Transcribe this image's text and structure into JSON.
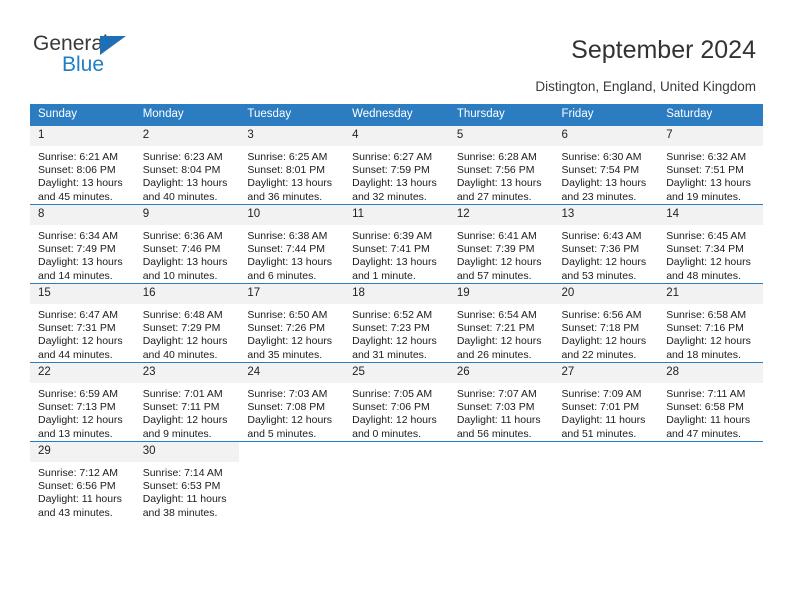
{
  "brand": {
    "name_top": "General",
    "name_bottom": "Blue",
    "accent_color": "#1f7ec4",
    "triangle_color": "#1f6fb5"
  },
  "header": {
    "title": "September 2024",
    "subtitle": "Distington, England, United Kingdom"
  },
  "calendar": {
    "header_bg": "#2b7cc0",
    "header_text_color": "#ffffff",
    "date_band_bg": "#f2f2f2",
    "weekday_headers": [
      "Sunday",
      "Monday",
      "Tuesday",
      "Wednesday",
      "Thursday",
      "Friday",
      "Saturday"
    ],
    "weeks": [
      [
        {
          "date": "1",
          "sunrise": "Sunrise: 6:21 AM",
          "sunset": "Sunset: 8:06 PM",
          "daylight_line1": "Daylight: 13 hours",
          "daylight_line2": "and 45 minutes."
        },
        {
          "date": "2",
          "sunrise": "Sunrise: 6:23 AM",
          "sunset": "Sunset: 8:04 PM",
          "daylight_line1": "Daylight: 13 hours",
          "daylight_line2": "and 40 minutes."
        },
        {
          "date": "3",
          "sunrise": "Sunrise: 6:25 AM",
          "sunset": "Sunset: 8:01 PM",
          "daylight_line1": "Daylight: 13 hours",
          "daylight_line2": "and 36 minutes."
        },
        {
          "date": "4",
          "sunrise": "Sunrise: 6:27 AM",
          "sunset": "Sunset: 7:59 PM",
          "daylight_line1": "Daylight: 13 hours",
          "daylight_line2": "and 32 minutes."
        },
        {
          "date": "5",
          "sunrise": "Sunrise: 6:28 AM",
          "sunset": "Sunset: 7:56 PM",
          "daylight_line1": "Daylight: 13 hours",
          "daylight_line2": "and 27 minutes."
        },
        {
          "date": "6",
          "sunrise": "Sunrise: 6:30 AM",
          "sunset": "Sunset: 7:54 PM",
          "daylight_line1": "Daylight: 13 hours",
          "daylight_line2": "and 23 minutes."
        },
        {
          "date": "7",
          "sunrise": "Sunrise: 6:32 AM",
          "sunset": "Sunset: 7:51 PM",
          "daylight_line1": "Daylight: 13 hours",
          "daylight_line2": "and 19 minutes."
        }
      ],
      [
        {
          "date": "8",
          "sunrise": "Sunrise: 6:34 AM",
          "sunset": "Sunset: 7:49 PM",
          "daylight_line1": "Daylight: 13 hours",
          "daylight_line2": "and 14 minutes."
        },
        {
          "date": "9",
          "sunrise": "Sunrise: 6:36 AM",
          "sunset": "Sunset: 7:46 PM",
          "daylight_line1": "Daylight: 13 hours",
          "daylight_line2": "and 10 minutes."
        },
        {
          "date": "10",
          "sunrise": "Sunrise: 6:38 AM",
          "sunset": "Sunset: 7:44 PM",
          "daylight_line1": "Daylight: 13 hours",
          "daylight_line2": "and 6 minutes."
        },
        {
          "date": "11",
          "sunrise": "Sunrise: 6:39 AM",
          "sunset": "Sunset: 7:41 PM",
          "daylight_line1": "Daylight: 13 hours",
          "daylight_line2": "and 1 minute."
        },
        {
          "date": "12",
          "sunrise": "Sunrise: 6:41 AM",
          "sunset": "Sunset: 7:39 PM",
          "daylight_line1": "Daylight: 12 hours",
          "daylight_line2": "and 57 minutes."
        },
        {
          "date": "13",
          "sunrise": "Sunrise: 6:43 AM",
          "sunset": "Sunset: 7:36 PM",
          "daylight_line1": "Daylight: 12 hours",
          "daylight_line2": "and 53 minutes."
        },
        {
          "date": "14",
          "sunrise": "Sunrise: 6:45 AM",
          "sunset": "Sunset: 7:34 PM",
          "daylight_line1": "Daylight: 12 hours",
          "daylight_line2": "and 48 minutes."
        }
      ],
      [
        {
          "date": "15",
          "sunrise": "Sunrise: 6:47 AM",
          "sunset": "Sunset: 7:31 PM",
          "daylight_line1": "Daylight: 12 hours",
          "daylight_line2": "and 44 minutes."
        },
        {
          "date": "16",
          "sunrise": "Sunrise: 6:48 AM",
          "sunset": "Sunset: 7:29 PM",
          "daylight_line1": "Daylight: 12 hours",
          "daylight_line2": "and 40 minutes."
        },
        {
          "date": "17",
          "sunrise": "Sunrise: 6:50 AM",
          "sunset": "Sunset: 7:26 PM",
          "daylight_line1": "Daylight: 12 hours",
          "daylight_line2": "and 35 minutes."
        },
        {
          "date": "18",
          "sunrise": "Sunrise: 6:52 AM",
          "sunset": "Sunset: 7:23 PM",
          "daylight_line1": "Daylight: 12 hours",
          "daylight_line2": "and 31 minutes."
        },
        {
          "date": "19",
          "sunrise": "Sunrise: 6:54 AM",
          "sunset": "Sunset: 7:21 PM",
          "daylight_line1": "Daylight: 12 hours",
          "daylight_line2": "and 26 minutes."
        },
        {
          "date": "20",
          "sunrise": "Sunrise: 6:56 AM",
          "sunset": "Sunset: 7:18 PM",
          "daylight_line1": "Daylight: 12 hours",
          "daylight_line2": "and 22 minutes."
        },
        {
          "date": "21",
          "sunrise": "Sunrise: 6:58 AM",
          "sunset": "Sunset: 7:16 PM",
          "daylight_line1": "Daylight: 12 hours",
          "daylight_line2": "and 18 minutes."
        }
      ],
      [
        {
          "date": "22",
          "sunrise": "Sunrise: 6:59 AM",
          "sunset": "Sunset: 7:13 PM",
          "daylight_line1": "Daylight: 12 hours",
          "daylight_line2": "and 13 minutes."
        },
        {
          "date": "23",
          "sunrise": "Sunrise: 7:01 AM",
          "sunset": "Sunset: 7:11 PM",
          "daylight_line1": "Daylight: 12 hours",
          "daylight_line2": "and 9 minutes."
        },
        {
          "date": "24",
          "sunrise": "Sunrise: 7:03 AM",
          "sunset": "Sunset: 7:08 PM",
          "daylight_line1": "Daylight: 12 hours",
          "daylight_line2": "and 5 minutes."
        },
        {
          "date": "25",
          "sunrise": "Sunrise: 7:05 AM",
          "sunset": "Sunset: 7:06 PM",
          "daylight_line1": "Daylight: 12 hours",
          "daylight_line2": "and 0 minutes."
        },
        {
          "date": "26",
          "sunrise": "Sunrise: 7:07 AM",
          "sunset": "Sunset: 7:03 PM",
          "daylight_line1": "Daylight: 11 hours",
          "daylight_line2": "and 56 minutes."
        },
        {
          "date": "27",
          "sunrise": "Sunrise: 7:09 AM",
          "sunset": "Sunset: 7:01 PM",
          "daylight_line1": "Daylight: 11 hours",
          "daylight_line2": "and 51 minutes."
        },
        {
          "date": "28",
          "sunrise": "Sunrise: 7:11 AM",
          "sunset": "Sunset: 6:58 PM",
          "daylight_line1": "Daylight: 11 hours",
          "daylight_line2": "and 47 minutes."
        }
      ],
      [
        {
          "date": "29",
          "sunrise": "Sunrise: 7:12 AM",
          "sunset": "Sunset: 6:56 PM",
          "daylight_line1": "Daylight: 11 hours",
          "daylight_line2": "and 43 minutes."
        },
        {
          "date": "30",
          "sunrise": "Sunrise: 7:14 AM",
          "sunset": "Sunset: 6:53 PM",
          "daylight_line1": "Daylight: 11 hours",
          "daylight_line2": "and 38 minutes."
        },
        {
          "date": "",
          "sunrise": "",
          "sunset": "",
          "daylight_line1": "",
          "daylight_line2": ""
        },
        {
          "date": "",
          "sunrise": "",
          "sunset": "",
          "daylight_line1": "",
          "daylight_line2": ""
        },
        {
          "date": "",
          "sunrise": "",
          "sunset": "",
          "daylight_line1": "",
          "daylight_line2": ""
        },
        {
          "date": "",
          "sunrise": "",
          "sunset": "",
          "daylight_line1": "",
          "daylight_line2": ""
        },
        {
          "date": "",
          "sunrise": "",
          "sunset": "",
          "daylight_line1": "",
          "daylight_line2": ""
        }
      ]
    ]
  }
}
